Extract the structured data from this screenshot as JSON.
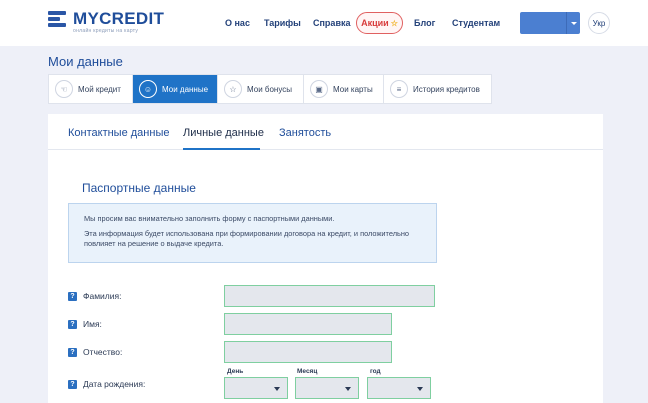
{
  "header": {
    "logo_title": "MYCREDIT",
    "logo_subtitle": "онлайн кредиты на карту",
    "nav": [
      "О нас",
      "Тарифы",
      "Справка",
      "Блог",
      "Студентам"
    ],
    "promo_label": "Акции",
    "promo_icon": "star-icon",
    "lang_label": "Укр"
  },
  "page": {
    "title": "Мои данные"
  },
  "section_tabs": [
    {
      "label": "Мой кредит",
      "icon": "thumb-icon",
      "active": false
    },
    {
      "label": "Мои данные",
      "icon": "user-icon",
      "active": true
    },
    {
      "label": "Мои бонусы",
      "icon": "star-icon",
      "active": false
    },
    {
      "label": "Мои карты",
      "icon": "card-icon",
      "active": false
    },
    {
      "label": "История кредитов",
      "icon": "list-icon",
      "active": false
    }
  ],
  "profile_tabs": [
    "Контактные данные",
    "Личные данные",
    "Занятость"
  ],
  "active_profile_tab": "Личные данные",
  "passport": {
    "title": "Паспортные данные",
    "info_1": "Мы просим вас внимательно заполнить форму с паспортными данными.",
    "info_2": "Эта информация будет использована при формировании договора на кредит, и положительно повлияет на решение о выдаче кредита.",
    "help_glyph": "?",
    "fields": {
      "last_name": {
        "label": "Фамилия:",
        "value": ""
      },
      "first_name": {
        "label": "Имя:",
        "value": ""
      },
      "patronymic": {
        "label": "Отчество:",
        "value": ""
      },
      "birth_date": {
        "label": "Дата рождения:",
        "day_label": "День",
        "month_label": "Месяц",
        "year_label": "год"
      }
    }
  },
  "colors": {
    "primary": "#1f73c7",
    "brand": "#1f4d9a",
    "promo": "#d83b3b",
    "field_border": "#7fcfa0",
    "info_bg": "#e9f2fb"
  }
}
